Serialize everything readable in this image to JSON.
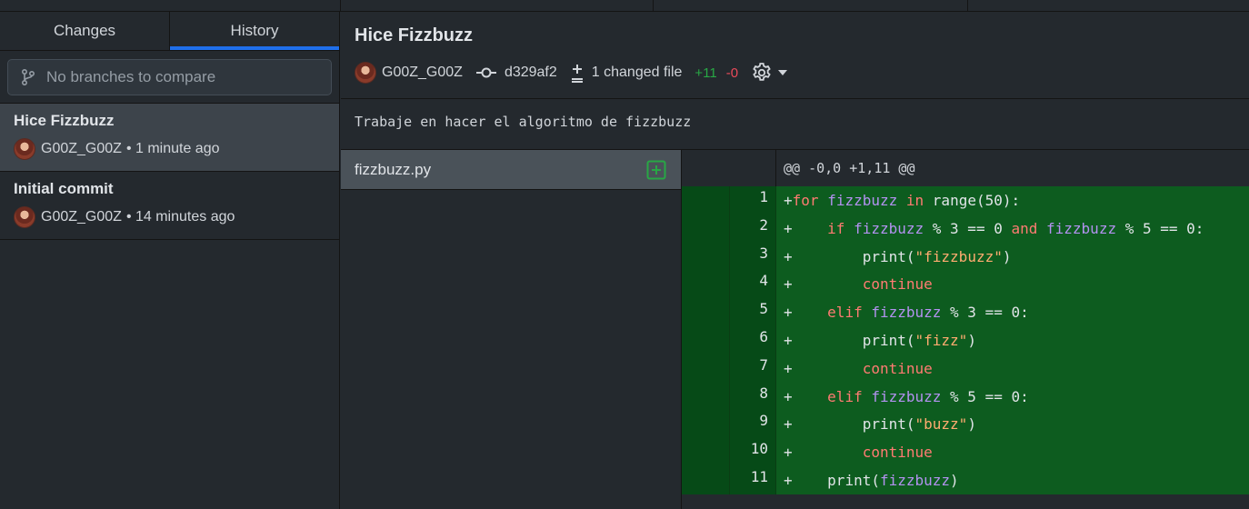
{
  "sidebar": {
    "tabs": [
      {
        "label": "Changes"
      },
      {
        "label": "History"
      }
    ],
    "branch_filter_placeholder": "No branches to compare",
    "commits": [
      {
        "title": "Hice Fizzbuzz",
        "author": "G00Z_G00Z",
        "time": "• 1 minute ago"
      },
      {
        "title": "Initial commit",
        "author": "G00Z_G00Z",
        "time": "• 14 minutes ago"
      }
    ]
  },
  "commit": {
    "title": "Hice Fizzbuzz",
    "author": "G00Z_G00Z",
    "sha": "d329af2",
    "changed_files": "1 changed file",
    "additions": "+11",
    "deletions": "-0",
    "description": "Trabaje en hacer el algoritmo de fizzbuzz"
  },
  "files": [
    {
      "name": "fizzbuzz.py",
      "status": "added"
    }
  ],
  "diff": {
    "hunk_header": "@@ -0,0 +1,11 @@",
    "lines": [
      {
        "num": "1",
        "prefix": "+",
        "code": "for fizzbuzz in range(50):"
      },
      {
        "num": "2",
        "prefix": "+",
        "code": "    if fizzbuzz % 3 == 0 and fizzbuzz % 5 == 0:"
      },
      {
        "num": "3",
        "prefix": "+",
        "code": "        print(\"fizzbuzz\")"
      },
      {
        "num": "4",
        "prefix": "+",
        "code": "        continue"
      },
      {
        "num": "5",
        "prefix": "+",
        "code": "    elif fizzbuzz % 3 == 0:"
      },
      {
        "num": "6",
        "prefix": "+",
        "code": "        print(\"fizz\")"
      },
      {
        "num": "7",
        "prefix": "+",
        "code": "        continue"
      },
      {
        "num": "8",
        "prefix": "+",
        "code": "    elif fizzbuzz % 5 == 0:"
      },
      {
        "num": "9",
        "prefix": "+",
        "code": "        print(\"buzz\")"
      },
      {
        "num": "10",
        "prefix": "+",
        "code": "        continue"
      },
      {
        "num": "11",
        "prefix": "+",
        "code": "    print(fizzbuzz)"
      }
    ]
  },
  "colors": {
    "accent": "#1f6feb",
    "added": "#28a745",
    "removed": "#ea4a5a",
    "diff_added_bg": "#0d5c1f"
  },
  "icons": {
    "branch": "git-branch-icon",
    "commit": "git-commit-icon",
    "diff": "file-diff-icon",
    "settings": "gear-icon",
    "dropdown": "caret-down-icon",
    "file_added": "diff-added-icon"
  }
}
